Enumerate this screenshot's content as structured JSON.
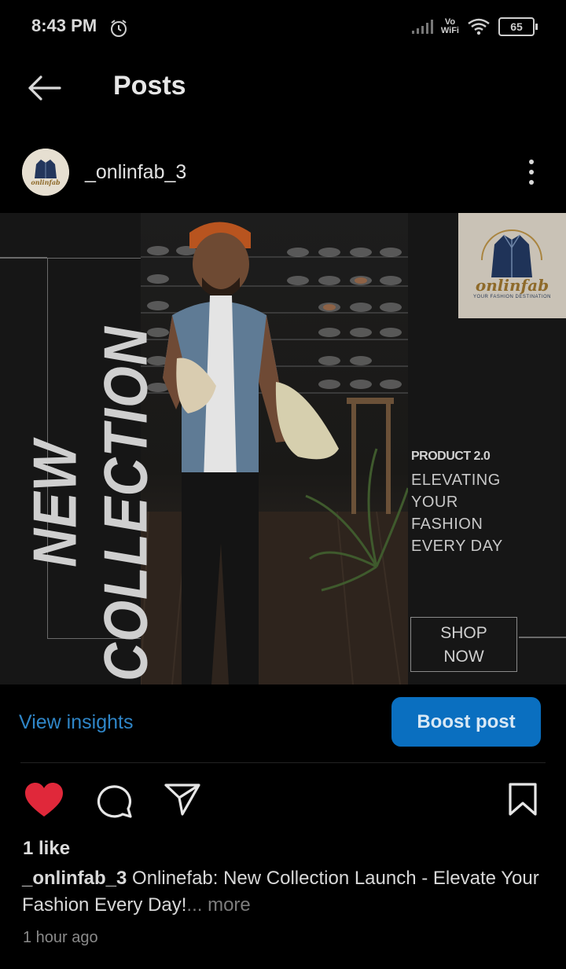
{
  "status_bar": {
    "time": "8:43 PM",
    "wifi_label_top": "Vo",
    "wifi_label_bottom": "WiFi",
    "battery": "65",
    "icons": [
      "alarm-icon",
      "signal-icon",
      "wifi-icon",
      "battery-icon"
    ]
  },
  "header": {
    "title": "Posts",
    "back_icon": "arrow-left-icon"
  },
  "post": {
    "username": "_onlinfab_3",
    "image": {
      "headline": "NEW COLLECTION",
      "logo_text": "onlinfab",
      "logo_tagline": "YOUR FASHION DESTINATION",
      "product_label": "PRODUCT 2.0",
      "tagline_lines": [
        "ELEVATING",
        "YOUR",
        "FASHION",
        "EVERY DAY"
      ],
      "cta_lines": [
        "SHOP",
        "NOW"
      ]
    },
    "view_insights": "View insights",
    "boost_label": "Boost post",
    "likes": "1 like",
    "caption_user": "_onlinfab_3",
    "caption_text": " Onlinefab: New Collection Launch - Elevate Your Fashion Every Day!",
    "caption_more": "... more",
    "time_ago": "1 hour ago"
  },
  "colors": {
    "background": "#000000",
    "link_blue": "#2f86c8",
    "boost_blue": "#0a6fc0",
    "like_red": "#e0283a"
  }
}
